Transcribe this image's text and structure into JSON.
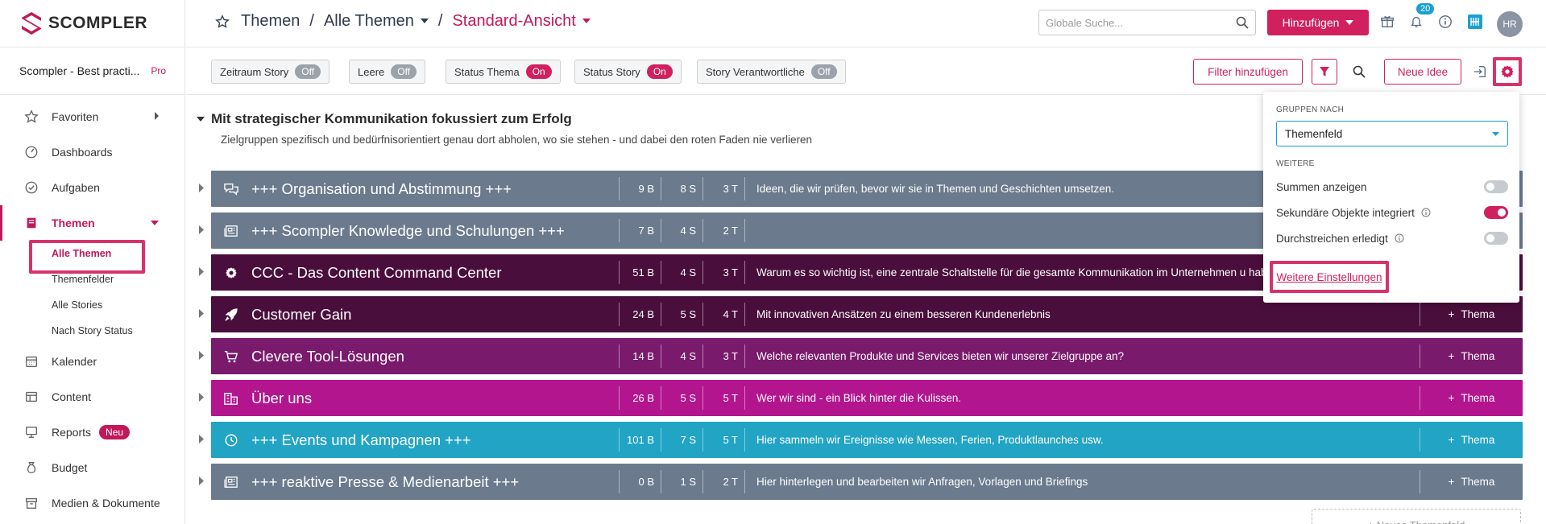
{
  "app": {
    "name": "SCOMPLER",
    "workspace": "Scompler - Best practi...",
    "plan": "Pro"
  },
  "colors": {
    "accent": "#d1205e",
    "highlight": "#d6336c",
    "info": "#1a9fd1"
  },
  "sidebar": {
    "items": [
      {
        "label": "Favoriten",
        "icon": "star-icon",
        "has_arrow": true
      },
      {
        "label": "Dashboards",
        "icon": "gauge-icon"
      },
      {
        "label": "Aufgaben",
        "icon": "check-circle-icon"
      },
      {
        "label": "Themen",
        "icon": "book-icon",
        "active": true
      },
      {
        "label": "Kalender",
        "icon": "calendar-icon"
      },
      {
        "label": "Content",
        "icon": "layout-icon"
      },
      {
        "label": "Reports",
        "icon": "monitor-icon",
        "badge": "Neu"
      },
      {
        "label": "Budget",
        "icon": "money-bag-icon"
      },
      {
        "label": "Medien & Dokumente",
        "icon": "archive-icon"
      }
    ],
    "sub_items": [
      {
        "label": "Alle Themen",
        "selected": true
      },
      {
        "label": "Themenfelder"
      },
      {
        "label": "Alle Stories"
      },
      {
        "label": "Nach Story Status"
      }
    ]
  },
  "header": {
    "crumb_1": "Themen",
    "crumb_2": "Alle Themen",
    "crumb_3": "Standard-Ansicht",
    "search_placeholder": "Globale Suche...",
    "add_label": "Hinzufügen",
    "notification_count": "20",
    "avatar": "HR"
  },
  "toolbar": {
    "chips": [
      {
        "label": "Zeitraum Story",
        "state": "Off"
      },
      {
        "label": "Leere",
        "state": "Off"
      },
      {
        "label": "Status Thema",
        "state": "On"
      },
      {
        "label": "Status Story",
        "state": "On"
      },
      {
        "label": "Story Verantwortliche",
        "state": "Off"
      }
    ],
    "filter_label": "Filter hinzufügen",
    "new_idea_label": "Neue Idee"
  },
  "section": {
    "title": "Mit strategischer Kommunikation fokussiert zum Erfolg",
    "subtitle": "Zielgruppen spezifisch und bedürfnisorientiert genau dort abholen, wo sie stehen - und dabei den roten Faden nie verlieren"
  },
  "themes": [
    {
      "title": "+++ Organisation und Abstimmung +++",
      "b": "9 B",
      "s": "8 S",
      "t": "3 T",
      "desc": "Ideen, die wir prüfen, bevor wir sie in Themen und Geschichten umsetzen.",
      "color": "#6b7a8d",
      "icon": "chat-icon",
      "add": ""
    },
    {
      "title": "+++ Scompler Knowledge und Schulungen +++",
      "b": "7 B",
      "s": "4 S",
      "t": "2 T",
      "desc": "",
      "color": "#6b7a8d",
      "icon": "newspaper-icon",
      "add": ""
    },
    {
      "title": "CCC - Das Content Command Center",
      "b": "51 B",
      "s": "4 S",
      "t": "3 T",
      "desc": "Warum es so wichtig ist, eine zentrale Schaltstelle für die gesamte Kommunikation im Unternehmen u hab",
      "color": "#4a0e3c",
      "icon": "cog-icon",
      "add": ""
    },
    {
      "title": "Customer Gain",
      "b": "24 B",
      "s": "5 S",
      "t": "4 T",
      "desc": "Mit innovativen Ansätzen zu einem besseren Kundenerlebnis",
      "color": "#4a0e3c",
      "icon": "rocket-icon",
      "add": "Thema"
    },
    {
      "title": "Clevere Tool-Lösungen",
      "b": "14 B",
      "s": "4 S",
      "t": "3 T",
      "desc": "Welche relevanten Produkte und Services bieten wir unserer Zielgruppe an?",
      "color": "#7a1a6c",
      "icon": "cart-icon",
      "add": "Thema"
    },
    {
      "title": "Über uns",
      "b": "26 B",
      "s": "5 S",
      "t": "5 T",
      "desc": "Wer wir sind - ein Blick hinter die Kulissen.",
      "color": "#b3158f",
      "icon": "building-icon",
      "add": "Thema"
    },
    {
      "title": "+++ Events und Kampagnen +++",
      "b": "101 B",
      "s": "7 S",
      "t": "5 T",
      "desc": "Hier sammeln wir Ereignisse wie Messen, Ferien, Produktlaunches usw.",
      "color": "#22a4c4",
      "icon": "clock-icon",
      "add": "Thema"
    },
    {
      "title": "+++ reaktive Presse & Medienarbeit +++",
      "b": "0 B",
      "s": "1 S",
      "t": "2 T",
      "desc": "Hier hinterlegen und bearbeiten wir Anfragen, Vorlagen und Briefings",
      "color": "#6b7a8d",
      "icon": "newspaper-icon",
      "add": "Thema"
    }
  ],
  "new_field_label": "+ Neues Themenfeld",
  "panel": {
    "group_label": "GRUPPEN NACH",
    "group_value": "Themenfeld",
    "more_label": "WEITERE",
    "options": [
      {
        "label": "Summen anzeigen",
        "on": false,
        "info": false
      },
      {
        "label": "Sekundäre Objekte integriert",
        "on": true,
        "info": true
      },
      {
        "label": "Durchstreichen erledigt",
        "on": false,
        "info": true
      }
    ],
    "settings_link": "Weitere Einstellungen"
  }
}
